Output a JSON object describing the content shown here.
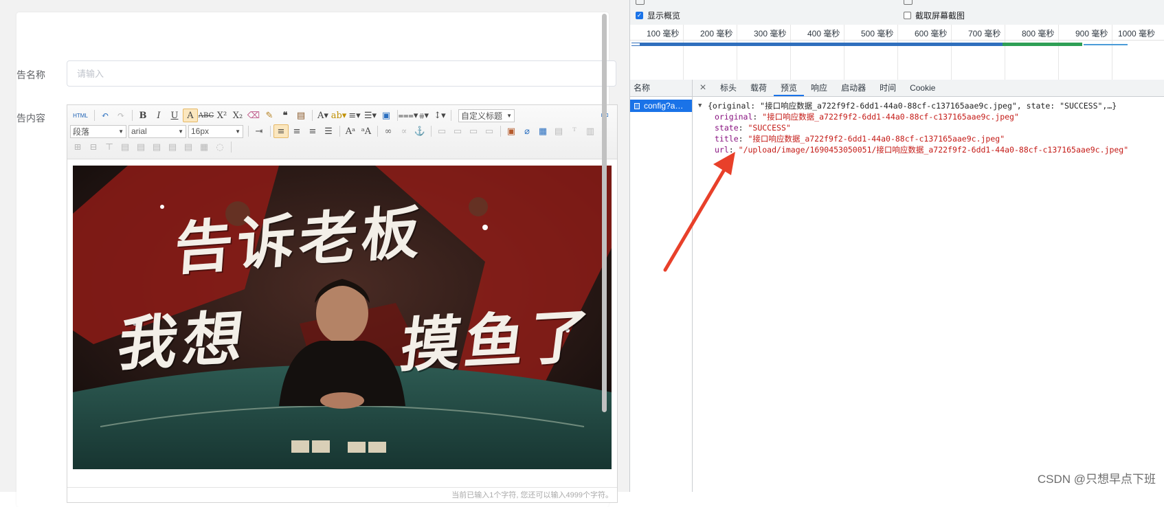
{
  "form": {
    "name_label": "告名称",
    "name_placeholder": "请输入",
    "content_label": "告内容"
  },
  "editor": {
    "toolbar": {
      "html": "HTML",
      "paragraph": "段落",
      "font": "arial",
      "size": "16px",
      "title_select": "自定义标题"
    },
    "status": "当前已输入1个字符, 您还可以输入4999个字符。",
    "hero_text": "告诉老板 我想摸鱼了"
  },
  "devtools": {
    "options": {
      "overview": "显示概览",
      "screenshot": "截取屏幕截图"
    },
    "ticks": [
      "100 毫秒",
      "200 毫秒",
      "300 毫秒",
      "400 毫秒",
      "500 毫秒",
      "600 毫秒",
      "700 毫秒",
      "800 毫秒",
      "900 毫秒",
      "1000 毫秒"
    ],
    "name_header": "名称",
    "request_name": "config?a…",
    "tabs": [
      "标头",
      "载荷",
      "预览",
      "响应",
      "启动器",
      "时间",
      "Cookie"
    ],
    "selected_tab": "预览",
    "json": {
      "summary": "{original: \"接口响应数据_a722f9f2-6dd1-44a0-88cf-c137165aae9c.jpeg\", state: \"SUCCESS\",…}",
      "original_key": "original",
      "original_val": "\"接口响应数据_a722f9f2-6dd1-44a0-88cf-c137165aae9c.jpeg\"",
      "state_key": "state",
      "state_val": "\"SUCCESS\"",
      "title_key": "title",
      "title_val": "\"接口响应数据_a722f9f2-6dd1-44a0-88cf-c137165aae9c.jpeg\"",
      "url_key": "url",
      "url_val": "\"/upload/image/1690453050051/接口响应数据_a722f9f2-6dd1-44a0-88cf-c137165aae9c.jpeg\""
    }
  },
  "watermark": "CSDN @只想早点下班",
  "colors": {
    "accent": "#1a73e8",
    "json_key": "#881280",
    "json_string": "#c41a16",
    "annotation_arrow": "#e8402a"
  }
}
